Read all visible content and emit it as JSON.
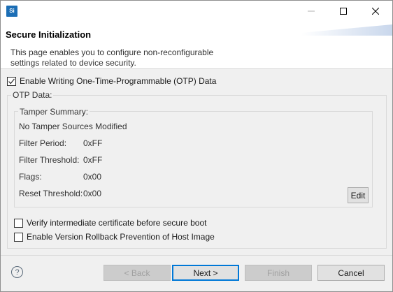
{
  "window": {
    "app_icon_text": "Si"
  },
  "banner": {
    "title": "Secure Initialization",
    "description": "This page enables you to configure non-reconfigurable settings related to device security."
  },
  "options": {
    "enable_otp_label": "Enable Writing One-Time-Programmable (OTP) Data",
    "enable_otp_checked": true,
    "verify_cert_label": "Verify intermediate certificate before secure boot",
    "verify_cert_checked": false,
    "rollback_label": "Enable Version Rollback Prevention of Host Image",
    "rollback_checked": false
  },
  "otp": {
    "group_label": "OTP Data:",
    "tamper": {
      "group_label": "Tamper Summary:",
      "status": "No Tamper Sources Modified",
      "fields": [
        {
          "label": "Filter Period:",
          "value": "0xFF"
        },
        {
          "label": "Filter Threshold:",
          "value": "0xFF"
        },
        {
          "label": "Flags:",
          "value": "0x00"
        },
        {
          "label": "Reset Threshold:",
          "value": "0x00"
        }
      ],
      "edit_label": "Edit"
    }
  },
  "footer": {
    "help_glyph": "?",
    "back_label": "< Back",
    "next_label": "Next >",
    "finish_label": "Finish",
    "cancel_label": "Cancel"
  },
  "colors": {
    "accent": "#0078d7",
    "app_icon": "#1c6eb5"
  }
}
